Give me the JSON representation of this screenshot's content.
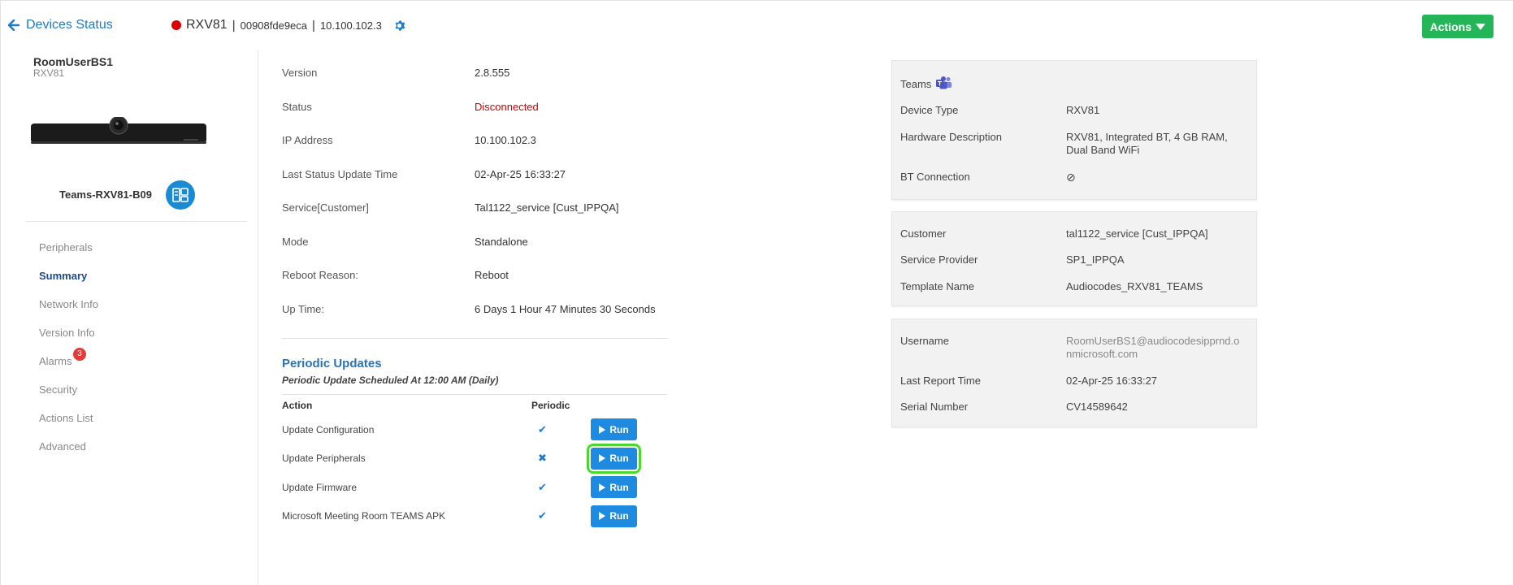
{
  "header": {
    "back_label": "Devices Status",
    "device_name": "RXV81",
    "separator": "|",
    "mac": "00908fde9eca",
    "ip": "10.100.102.3",
    "actions_label": "Actions",
    "status_color": "#d90000"
  },
  "sidebar": {
    "user_name": "RoomUserBS1",
    "user_model": "RXV81",
    "device_label": "Teams-RXV81-B09",
    "nav": [
      {
        "label": "Peripherals"
      },
      {
        "label": "Summary"
      },
      {
        "label": "Network Info"
      },
      {
        "label": "Version Info"
      },
      {
        "label": "Alarms",
        "badge": "3"
      },
      {
        "label": "Security"
      },
      {
        "label": "Actions List"
      },
      {
        "label": "Advanced"
      }
    ],
    "active": "Summary"
  },
  "main": {
    "info": [
      {
        "label": "Version",
        "value": "2.8.555"
      },
      {
        "label": "Status",
        "value": "Disconnected"
      },
      {
        "label": "IP Address",
        "value": "10.100.102.3"
      },
      {
        "label": "Last Status Update Time",
        "value": "02-Apr-25 16:33:27"
      },
      {
        "label": "Service[Customer]",
        "value": "Tal1122_service [Cust_IPPQA]"
      },
      {
        "label": "Mode",
        "value": "Standalone"
      },
      {
        "label": "Reboot Reason:",
        "value": "Reboot"
      },
      {
        "label": "Up Time:",
        "value": "6 Days 1 Hour 47 Minutes 30 Seconds"
      }
    ],
    "periodic": {
      "title": "Periodic Updates",
      "subtitle": "Periodic Update Scheduled At 12:00 AM (Daily)",
      "col_action": "Action",
      "col_periodic": "Periodic",
      "run_label": "Run",
      "rows": [
        {
          "action": "Update Configuration",
          "periodic": "✔"
        },
        {
          "action": "Update Peripherals",
          "periodic": "✖"
        },
        {
          "action": "Update Firmware",
          "periodic": "✔"
        },
        {
          "action": "Microsoft Meeting Room TEAMS APK",
          "periodic": "✔"
        }
      ]
    }
  },
  "panels": {
    "teams": {
      "title": "Teams",
      "rows": [
        {
          "label": "Device Type",
          "value": "RXV81"
        },
        {
          "label": "Hardware Description",
          "value": "RXV81, Integrated BT, 4 GB RAM, Dual Band WiFi"
        },
        {
          "label": "BT Connection",
          "value": "⊘"
        }
      ]
    },
    "customer": {
      "rows": [
        {
          "label": "Customer",
          "value": "tal1122_service [Cust_IPPQA]"
        },
        {
          "label": "Service Provider",
          "value": "SP1_IPPQA"
        },
        {
          "label": "Template Name",
          "value": "Audiocodes_RXV81_TEAMS"
        }
      ]
    },
    "user": {
      "rows": [
        {
          "label": "Username",
          "value": "RoomUserBS1@audiocodesipprnd.onmicrosoft.com"
        },
        {
          "label": "Last Report Time",
          "value": "02-Apr-25 16:33:27"
        },
        {
          "label": "Serial Number",
          "value": "CV14589642"
        }
      ]
    }
  }
}
